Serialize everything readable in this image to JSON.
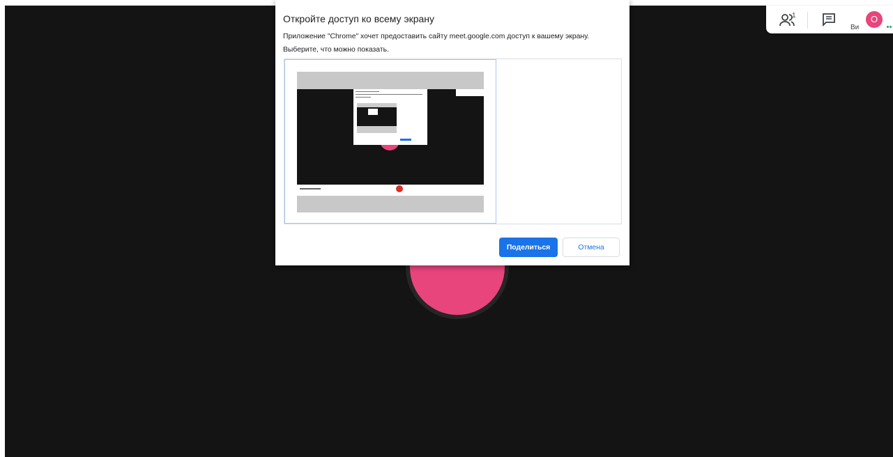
{
  "dialog": {
    "title": "Откройте доступ ко всему экрану",
    "description": "Приложение \"Chrome\" хочет предоставить сайту meet.google.com доступ к вашему экрану. Выберите, что можно показать.",
    "share_label": "Поделиться",
    "cancel_label": "Отмена"
  },
  "topbar": {
    "participant_count": "1",
    "user_label": "Ви",
    "avatar_letter": "О"
  },
  "colors": {
    "accent": "#1a73e8",
    "avatar": "#e8457c",
    "background": "#141414"
  },
  "icons": [
    "people-icon",
    "chat-icon"
  ]
}
